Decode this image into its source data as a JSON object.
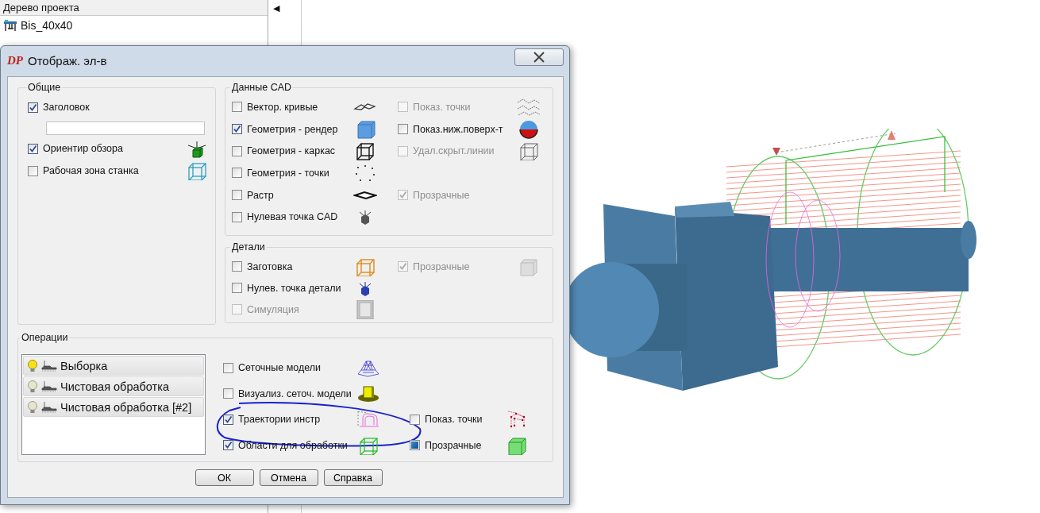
{
  "project_tree": {
    "title": "Дерево проекта",
    "items": [
      {
        "label": "Bis_40x40"
      }
    ]
  },
  "viewport": {
    "collapse_glyph": "◀"
  },
  "dialog": {
    "logo": "DP",
    "title": "Отображ. эл-в",
    "general": {
      "title": "Общие",
      "items": [
        {
          "kind": "checkbox",
          "label": "Заголовок",
          "checked": true,
          "disabled": false
        },
        {
          "kind": "field"
        },
        {
          "kind": "checkbox",
          "label": "Ориентир обзора",
          "checked": true,
          "disabled": false
        },
        {
          "kind": "checkbox",
          "label": "Рабочая зона станка",
          "checked": false,
          "disabled": false
        }
      ]
    },
    "cad_data": {
      "title": "Данные CAD",
      "rows": [
        {
          "left": {
            "label": "Вектор. кривые",
            "checked": false,
            "disabled": false
          },
          "right": {
            "label": "Показ. точки",
            "checked": false,
            "disabled": true
          }
        },
        {
          "left": {
            "label": "Геометрия - рендер",
            "checked": true,
            "disabled": false
          },
          "right": {
            "label": "Показ.ниж.поверх-т",
            "checked": false,
            "disabled": false
          }
        },
        {
          "left": {
            "label": "Геометрия - каркас",
            "checked": false,
            "disabled": false
          },
          "right": {
            "label": "Удал.скрыт.линии",
            "checked": false,
            "disabled": true
          }
        },
        {
          "left": {
            "label": "Геометрия - точки",
            "checked": false,
            "disabled": false
          }
        },
        {
          "left": {
            "label": "Растр",
            "checked": false,
            "disabled": false
          },
          "right": {
            "label": "Прозрачные",
            "checked": true,
            "disabled": true
          }
        },
        {
          "left": {
            "label": "Нулевая точка CAD",
            "checked": false,
            "disabled": false
          }
        }
      ]
    },
    "parts": {
      "title": "Детали",
      "rows": [
        {
          "left": {
            "label": "Заготовка",
            "checked": false,
            "disabled": false
          },
          "right": {
            "label": "Прозрачные",
            "checked": true,
            "disabled": true
          }
        },
        {
          "left": {
            "label": "Нулев. точка детали",
            "checked": false,
            "disabled": false
          }
        },
        {
          "left": {
            "label": "Симуляция",
            "checked": false,
            "disabled": true
          }
        }
      ]
    },
    "operations": {
      "title": "Операции",
      "list": [
        {
          "label": "Выборка",
          "lit": true
        },
        {
          "label": "Чистовая обработка",
          "lit": false
        },
        {
          "label": "Чистовая обработка [#2]",
          "lit": false
        }
      ],
      "rows": [
        {
          "left": {
            "label": "Сеточные модели",
            "checked": false,
            "disabled": false,
            "indeterminate": false
          }
        },
        {
          "left": {
            "label": "Визуализ. сеточ. модели",
            "checked": false,
            "disabled": false,
            "indeterminate": false
          }
        },
        {
          "left": {
            "label": "Траектории инстр",
            "checked": true,
            "disabled": false,
            "indeterminate": false
          },
          "right": {
            "label": "Показ. точки",
            "checked": false,
            "disabled": false,
            "indeterminate": false
          }
        },
        {
          "left": {
            "label": "Области для обработки",
            "checked": true,
            "disabled": false,
            "indeterminate": false
          },
          "right": {
            "label": "Прозрачные",
            "checked": false,
            "disabled": false,
            "indeterminate": true
          }
        }
      ]
    },
    "buttons": [
      "ОК",
      "Отмена",
      "Справка"
    ]
  }
}
